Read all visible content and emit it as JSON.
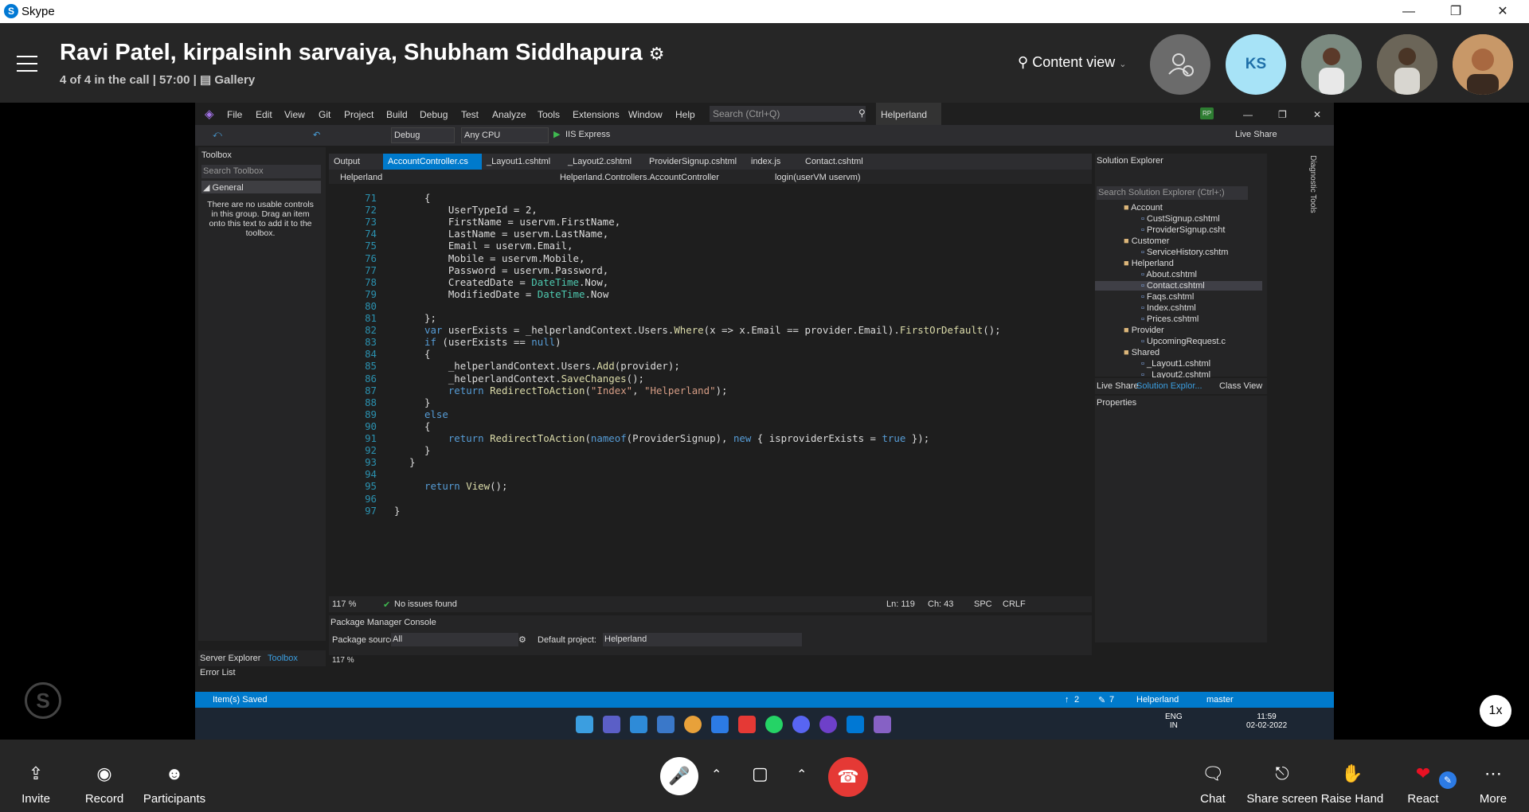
{
  "window": {
    "app_name": "Skype"
  },
  "call": {
    "title": "Ravi Patel, kirpalsinh sarvaiya, Shubham Siddhapura",
    "status": "4 of 4 in the call | 57:00 |",
    "layout_label": "Gallery",
    "content_view_label": "Content view",
    "participant_initials": "KS",
    "speed_label": "1x"
  },
  "vs": {
    "menu": [
      "File",
      "Edit",
      "View",
      "Git",
      "Project",
      "Build",
      "Debug",
      "Test",
      "Analyze",
      "Tools",
      "Extensions",
      "Window",
      "Help"
    ],
    "search_placeholder": "Search (Ctrl+Q)",
    "solution_name": "Helperland",
    "user_initials": "RP",
    "live_share": "Live Share",
    "toolbar": {
      "config": "Debug",
      "platform": "Any CPU",
      "run": "IIS Express"
    },
    "toolbox": {
      "title": "Toolbox",
      "search": "Search Toolbox",
      "group": "General",
      "empty_msg": "There are no usable controls in this group. Drag an item onto this text to add it to the toolbox."
    },
    "tabs": [
      "Output",
      "AccountController.cs",
      "_Layout1.cshtml",
      "_Layout2.cshtml",
      "ProviderSignup.cshtml",
      "index.js",
      "Contact.cshtml"
    ],
    "nav": {
      "project": "Helperland",
      "class": "Helperland.Controllers.AccountController",
      "member": "login(userVM uservm)"
    },
    "code_lines": [
      {
        "n": "71",
        "t": "{"
      },
      {
        "n": "72",
        "t": "    UserTypeId = 2,"
      },
      {
        "n": "73",
        "t": "    FirstName = uservm.FirstName,"
      },
      {
        "n": "74",
        "t": "    LastName = uservm.LastName,"
      },
      {
        "n": "75",
        "t": "    Email = uservm.Email,"
      },
      {
        "n": "76",
        "t": "    Mobile = uservm.Mobile,"
      },
      {
        "n": "77",
        "t": "    Password = uservm.Password,"
      },
      {
        "n": "78",
        "t": "    CreatedDate = DateTime.Now,"
      },
      {
        "n": "79",
        "t": "    ModifiedDate = DateTime.Now"
      },
      {
        "n": "80",
        "t": ""
      },
      {
        "n": "81",
        "t": "};"
      },
      {
        "n": "82",
        "t": "var userExists = _helperlandContext.Users.Where(x => x.Email == provider.Email).FirstOrDefault();"
      },
      {
        "n": "83",
        "t": "if (userExists == null)"
      },
      {
        "n": "84",
        "t": "{"
      },
      {
        "n": "85",
        "t": "    _helperlandContext.Users.Add(provider);"
      },
      {
        "n": "86",
        "t": "    _helperlandContext.SaveChanges();"
      },
      {
        "n": "87",
        "t": "    return RedirectToAction(\"Index\", \"Helperland\");"
      },
      {
        "n": "88",
        "t": "}"
      },
      {
        "n": "89",
        "t": "else"
      },
      {
        "n": "90",
        "t": "{"
      },
      {
        "n": "91",
        "t": "    return RedirectToAction(nameof(ProviderSignup), new { isproviderExists = true });"
      },
      {
        "n": "92",
        "t": "}"
      },
      {
        "n": "93",
        "t": "}"
      },
      {
        "n": "94",
        "t": ""
      },
      {
        "n": "95",
        "t": "return View();"
      },
      {
        "n": "96",
        "t": ""
      },
      {
        "n": "97",
        "t": "}"
      }
    ],
    "editor_status": {
      "zoom": "117 %",
      "issues": "No issues found",
      "line": "Ln: 119",
      "col": "Ch: 43",
      "spc": "SPC",
      "crlf": "CRLF"
    },
    "pmc": {
      "title": "Package Manager Console",
      "source_label": "Package source:",
      "source": "All",
      "project_label": "Default project:",
      "project": "Helperland",
      "zoom": "117 %"
    },
    "solution_explorer": {
      "title": "Solution Explorer",
      "search": "Search Solution Explorer (Ctrl+;)",
      "items": [
        {
          "label": "Account",
          "folder": true,
          "indent": 0
        },
        {
          "label": "CustSignup.cshtml",
          "folder": false,
          "indent": 1
        },
        {
          "label": "ProviderSignup.csht",
          "folder": false,
          "indent": 1
        },
        {
          "label": "Customer",
          "folder": true,
          "indent": 0
        },
        {
          "label": "ServiceHistory.cshtm",
          "folder": false,
          "indent": 1
        },
        {
          "label": "Helperland",
          "folder": true,
          "indent": 0
        },
        {
          "label": "About.cshtml",
          "folder": false,
          "indent": 1
        },
        {
          "label": "Contact.cshtml",
          "folder": false,
          "indent": 1,
          "selected": true
        },
        {
          "label": "Faqs.cshtml",
          "folder": false,
          "indent": 1
        },
        {
          "label": "Index.cshtml",
          "folder": false,
          "indent": 1
        },
        {
          "label": "Prices.cshtml",
          "folder": false,
          "indent": 1
        },
        {
          "label": "Provider",
          "folder": true,
          "indent": 0
        },
        {
          "label": "UpcomingRequest.c",
          "folder": false,
          "indent": 1
        },
        {
          "label": "Shared",
          "folder": true,
          "indent": 0
        },
        {
          "label": "_Layout1.cshtml",
          "folder": false,
          "indent": 1
        },
        {
          "label": "_Layout2.cshtml",
          "folder": false,
          "indent": 1
        }
      ],
      "bottom_tabs": [
        "Live Share",
        "Solution Explor...",
        "Class View"
      ]
    },
    "properties_title": "Properties",
    "left_tabs": [
      "Server Explorer",
      "Toolbox"
    ],
    "error_list": "Error List",
    "diag_tools": "Diagnostic Tools",
    "status": {
      "message": "Item(s) Saved",
      "up": "2",
      "pencil": "7",
      "repo": "Helperland",
      "branch": "master"
    },
    "taskbar": {
      "lang": "ENG",
      "region": "IN",
      "time": "11:59",
      "date": "02-02-2022"
    }
  },
  "controls": {
    "invite": "Invite",
    "record": "Record",
    "participants": "Participants",
    "chat": "Chat",
    "share": "Share screen",
    "raise": "Raise Hand",
    "react": "React",
    "more": "More"
  },
  "colors": {
    "accent": "#007acc",
    "hangup": "#e53935",
    "react_heart": "#e81123",
    "avatar_ks": "#a7e3f7"
  }
}
